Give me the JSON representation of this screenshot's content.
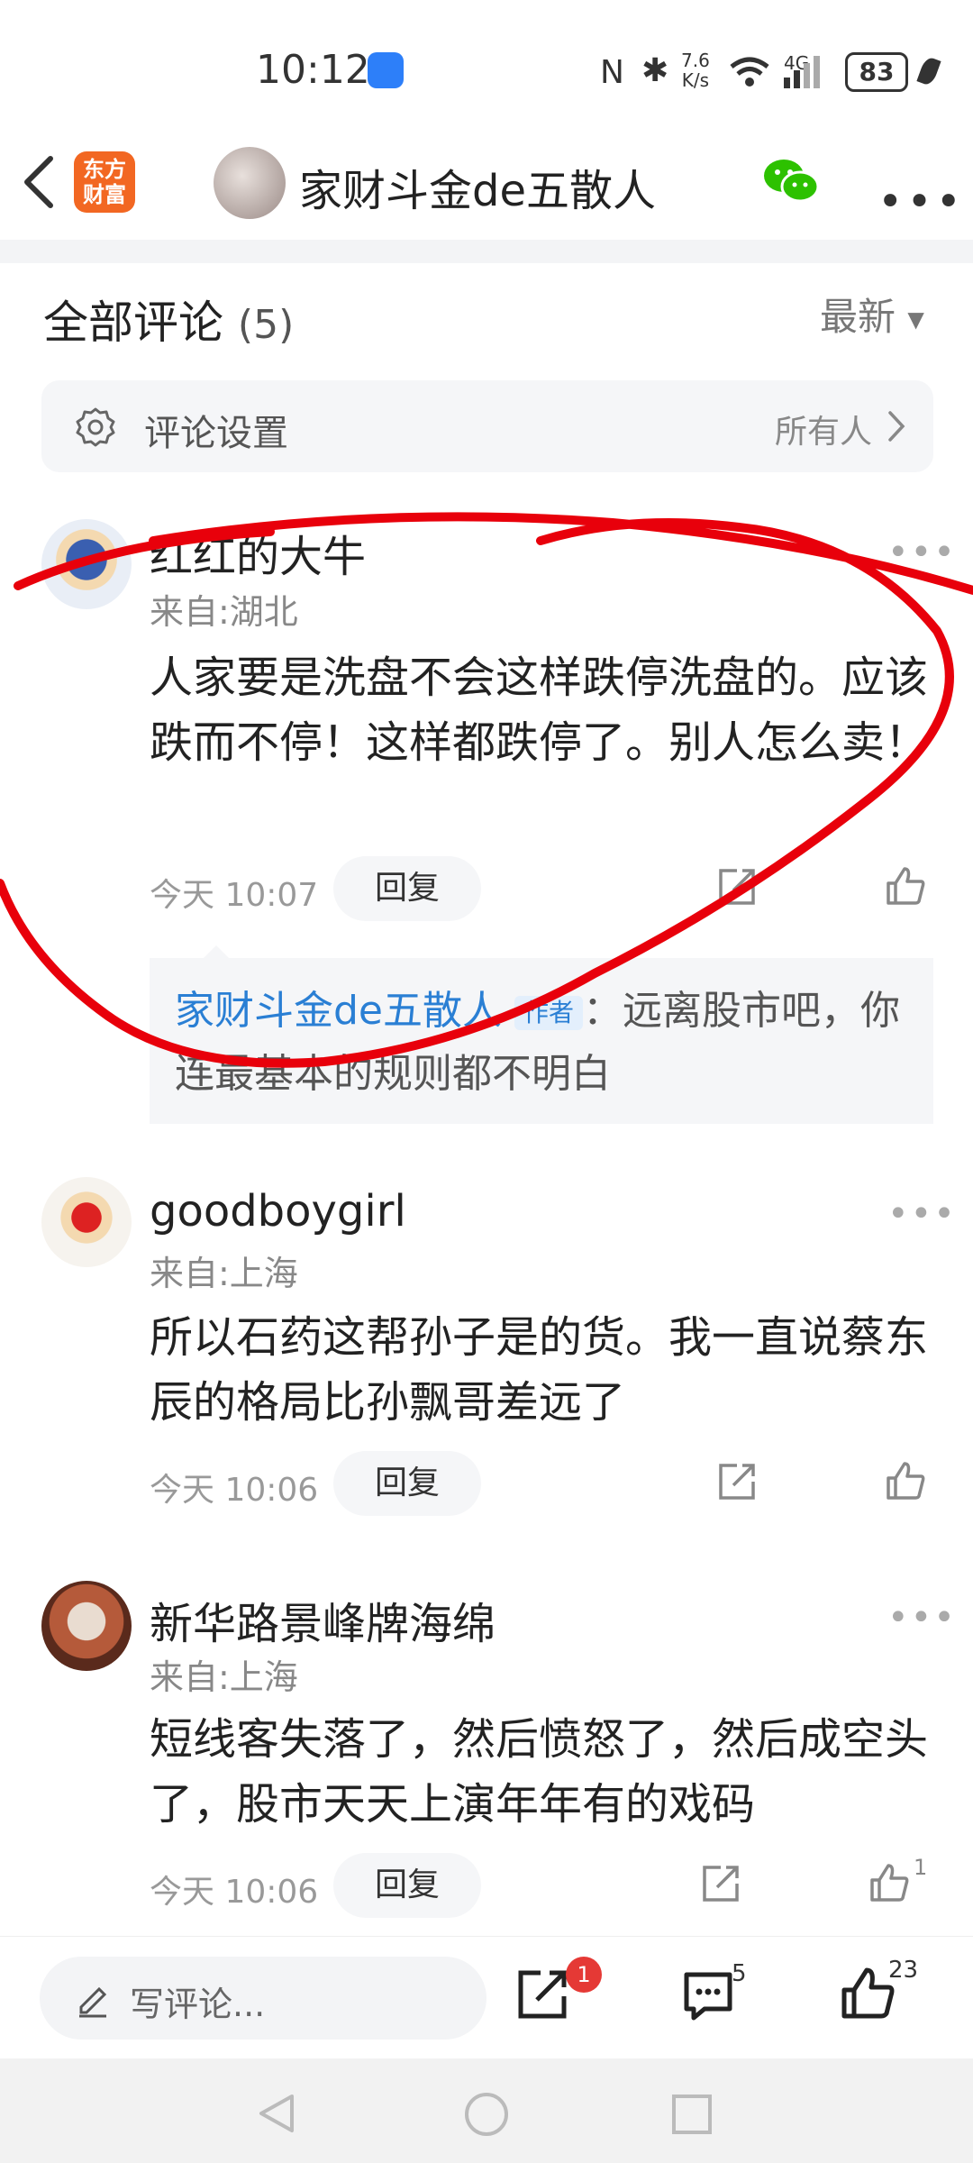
{
  "status_bar": {
    "time": "10:12",
    "net_speed_top": "7.6",
    "net_speed_bottom": "K/s",
    "network": "4G",
    "battery": "83"
  },
  "header": {
    "logo_line1": "东方",
    "logo_line2": "财富",
    "title": "家财斗金de五散人"
  },
  "comments_header": {
    "title": "全部评论",
    "count": "(5)",
    "sort": "最新"
  },
  "settings": {
    "label": "评论设置",
    "value": "所有人"
  },
  "comments": [
    {
      "user": "红红的大牛",
      "location": "来自:湖北",
      "text": "人家要是洗盘不会这样跌停洗盘的。应该跌而不停！这样都跌停了。别人怎么卖！",
      "time": "今天 10:07",
      "reply": "回复",
      "likes": ""
    },
    {
      "user": "goodboygirl",
      "location": "来自:上海",
      "text": "所以石药这帮孙子是的货。我一直说蔡东辰的格局比孙飘哥差远了",
      "time": "今天 10:06",
      "reply": "回复",
      "likes": ""
    },
    {
      "user": "新华路景峰牌海绵",
      "location": "来自:上海",
      "text": "短线客失落了，然后愤怒了，然后成空头了，股市天天上演年年有的戏码",
      "time": "今天 10:06",
      "reply": "回复",
      "likes": "1"
    }
  ],
  "quote": {
    "author": "家财斗金de五散人",
    "badge": "作者",
    "text": "：远离股市吧，你连最基本的规则都不明白"
  },
  "bottom_bar": {
    "placeholder": "写评论...",
    "share_badge": "1",
    "comment_count": "5",
    "like_count": "23"
  },
  "colors": {
    "accent": "#2a7fd4",
    "brand": "#f26722",
    "annotation": "#e8000b"
  }
}
